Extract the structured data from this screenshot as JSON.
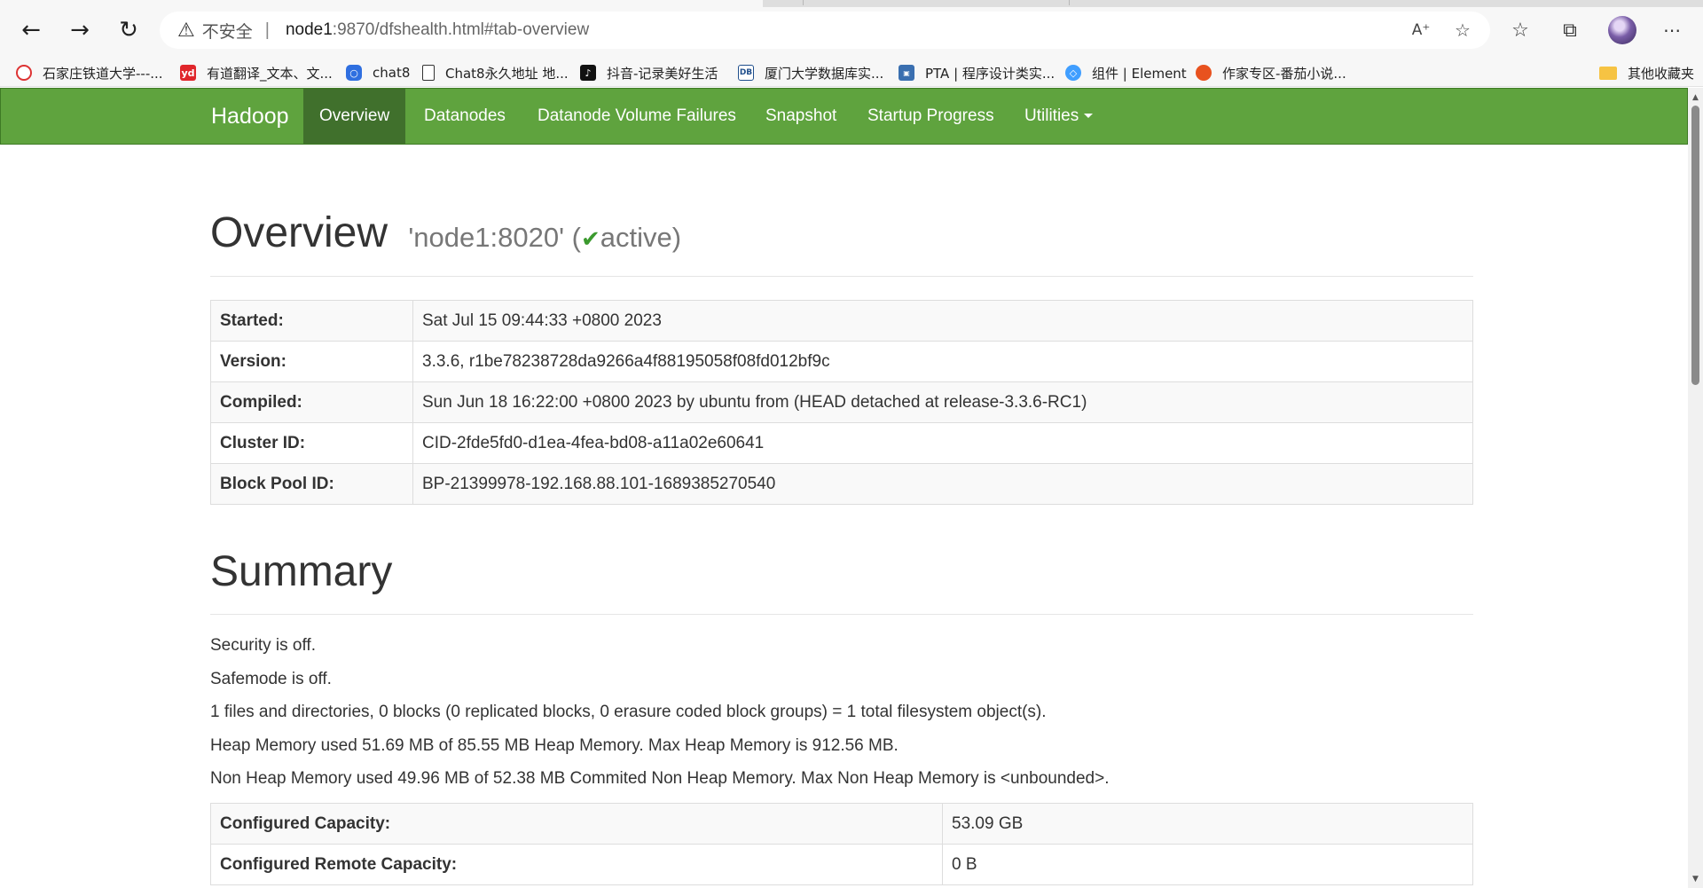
{
  "browser": {
    "address": {
      "security_label": "不安全",
      "url_host": "node1",
      "url_rest": ":9870/dfshealth.html#tab-overview"
    },
    "bookmarks": [
      {
        "label": "石家庄铁道大学---...",
        "icon": "university-icon",
        "color": "#d33"
      },
      {
        "label": "有道翻译_文本、文...",
        "icon": "youdao-icon",
        "color": "#e0262b"
      },
      {
        "label": "chat8",
        "icon": "chat-icon",
        "color": "#2f6fe0"
      },
      {
        "label": "Chat8永久地址 地...",
        "icon": "page-icon",
        "color": "#ffffff"
      },
      {
        "label": "抖音-记录美好生活",
        "icon": "douyin-icon",
        "color": "#111111"
      },
      {
        "label": "厦门大学数据库实...",
        "icon": "dblab-icon",
        "color": "#1f4e8c"
      },
      {
        "label": "PTA | 程序设计类实...",
        "icon": "pta-icon",
        "color": "#3a6fb0"
      },
      {
        "label": "组件 | Element",
        "icon": "element-icon",
        "color": "#409eff"
      },
      {
        "label": "作家专区-番茄小说...",
        "icon": "tomato-icon",
        "color": "#e8521f"
      }
    ],
    "other_bookmarks": "其他收藏夹"
  },
  "nav": {
    "brand": "Hadoop",
    "items": [
      {
        "label": "Overview",
        "active": true
      },
      {
        "label": "Datanodes",
        "active": false
      },
      {
        "label": "Datanode Volume Failures",
        "active": false
      },
      {
        "label": "Snapshot",
        "active": false
      },
      {
        "label": "Startup Progress",
        "active": false
      },
      {
        "label": "Utilities",
        "active": false
      }
    ]
  },
  "overview": {
    "title": "Overview",
    "node": "'node1:8020'",
    "paren_open": "(",
    "check": "✔",
    "state": "active",
    "paren_close": ")",
    "rows": [
      {
        "key": "Started:",
        "value": "Sat Jul 15 09:44:33 +0800 2023"
      },
      {
        "key": "Version:",
        "value": "3.3.6, r1be78238728da9266a4f88195058f08fd012bf9c"
      },
      {
        "key": "Compiled:",
        "value": "Sun Jun 18 16:22:00 +0800 2023 by ubuntu from (HEAD detached at release-3.3.6-RC1)"
      },
      {
        "key": "Cluster ID:",
        "value": "CID-2fde5fd0-d1ea-4fea-bd08-a11a02e60641"
      },
      {
        "key": "Block Pool ID:",
        "value": "BP-21399978-192.168.88.101-1689385270540"
      }
    ]
  },
  "summary": {
    "title": "Summary",
    "lines": [
      "Security is off.",
      "Safemode is off.",
      "1 files and directories, 0 blocks (0 replicated blocks, 0 erasure coded block groups) = 1 total filesystem object(s).",
      "Heap Memory used 51.69 MB of 85.55 MB Heap Memory. Max Heap Memory is 912.56 MB.",
      "Non Heap Memory used 49.96 MB of 52.38 MB Commited Non Heap Memory. Max Non Heap Memory is <unbounded>."
    ],
    "rows": [
      {
        "key": "Configured Capacity:",
        "value": "53.09 GB"
      },
      {
        "key": "Configured Remote Capacity:",
        "value": "0 B"
      }
    ]
  },
  "colors": {
    "navbar": "#5fa33e",
    "navbar_active": "#40702c",
    "active_check": "#3b9a2e"
  }
}
